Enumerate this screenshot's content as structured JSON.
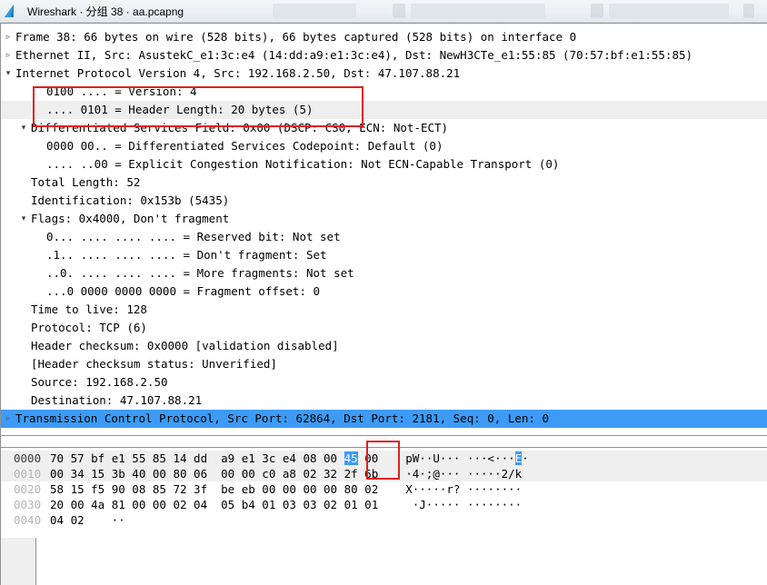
{
  "window": {
    "title": "Wireshark · 分组 38 · aa.pcapng",
    "logo_icon": "wireshark-fin-logo"
  },
  "detail_tree": {
    "rows": [
      {
        "indent": 0,
        "twig": "collapsed",
        "text": "Frame 38: 66 bytes on wire (528 bits), 66 bytes captured (528 bits) on interface 0",
        "state": "normal"
      },
      {
        "indent": 0,
        "twig": "collapsed",
        "text": "Ethernet II, Src: AsustekC_e1:3c:e4 (14:dd:a9:e1:3c:e4), Dst: NewH3CTe_e1:55:85 (70:57:bf:e1:55:85)",
        "state": "normal"
      },
      {
        "indent": 0,
        "twig": "expanded",
        "text": "Internet Protocol Version 4, Src: 192.168.2.50, Dst: 47.107.88.21",
        "state": "normal"
      },
      {
        "indent": 2,
        "twig": "none",
        "text": "0100 .... = Version: 4",
        "state": "normal"
      },
      {
        "indent": 2,
        "twig": "none",
        "text": ".... 0101 = Header Length: 20 bytes (5)",
        "state": "selected-field"
      },
      {
        "indent": 1,
        "twig": "expanded",
        "text": "Differentiated Services Field: 0x00 (DSCP: CS0, ECN: Not-ECT)",
        "state": "normal"
      },
      {
        "indent": 2,
        "twig": "none",
        "text": "0000 00.. = Differentiated Services Codepoint: Default (0)",
        "state": "normal"
      },
      {
        "indent": 2,
        "twig": "none",
        "text": ".... ..00 = Explicit Congestion Notification: Not ECN-Capable Transport (0)",
        "state": "normal"
      },
      {
        "indent": 1,
        "twig": "none",
        "text": "Total Length: 52",
        "state": "normal"
      },
      {
        "indent": 1,
        "twig": "none",
        "text": "Identification: 0x153b (5435)",
        "state": "normal"
      },
      {
        "indent": 1,
        "twig": "expanded",
        "text": "Flags: 0x4000, Don't fragment",
        "state": "normal"
      },
      {
        "indent": 2,
        "twig": "none",
        "text": "0... .... .... .... = Reserved bit: Not set",
        "state": "normal"
      },
      {
        "indent": 2,
        "twig": "none",
        "text": ".1.. .... .... .... = Don't fragment: Set",
        "state": "normal"
      },
      {
        "indent": 2,
        "twig": "none",
        "text": "..0. .... .... .... = More fragments: Not set",
        "state": "normal"
      },
      {
        "indent": 2,
        "twig": "none",
        "text": "...0 0000 0000 0000 = Fragment offset: 0",
        "state": "normal"
      },
      {
        "indent": 1,
        "twig": "none",
        "text": "Time to live: 128",
        "state": "normal"
      },
      {
        "indent": 1,
        "twig": "none",
        "text": "Protocol: TCP (6)",
        "state": "normal"
      },
      {
        "indent": 1,
        "twig": "none",
        "text": "Header checksum: 0x0000 [validation disabled]",
        "state": "normal"
      },
      {
        "indent": 1,
        "twig": "none",
        "text": "[Header checksum status: Unverified]",
        "state": "normal"
      },
      {
        "indent": 1,
        "twig": "none",
        "text": "Source: 192.168.2.50",
        "state": "normal"
      },
      {
        "indent": 1,
        "twig": "none",
        "text": "Destination: 47.107.88.21",
        "state": "normal"
      },
      {
        "indent": 0,
        "twig": "collapsed",
        "text": "Transmission Control Protocol, Src Port: 62864, Dst Port: 2181, Seq: 0, Len: 0",
        "state": "selected-row"
      }
    ]
  },
  "hex_dump": {
    "rows": [
      {
        "offset": "0000",
        "bytes_pre": "70 57 bf e1 55 85 14 dd  a9 e1 3c e4 08 00 ",
        "bytes_hl": "45",
        "bytes_post": " 00",
        "ascii_pre": "pW··U··· ···<···",
        "ascii_hl": "E",
        "ascii_post": "·",
        "shaded": true
      },
      {
        "offset": "0010",
        "bytes_pre": "00 34 15 3b 40 00 80 06  00 00 c0 a8 02 32 2f 6b",
        "bytes_hl": "",
        "bytes_post": "",
        "ascii_pre": "·4·;@··· ·····2/k",
        "ascii_hl": "",
        "ascii_post": "",
        "shaded": true
      },
      {
        "offset": "0020",
        "bytes_pre": "58 15 f5 90 08 85 72 3f  be eb 00 00 00 00 80 02",
        "bytes_hl": "",
        "bytes_post": "",
        "ascii_pre": "X·····r? ········",
        "ascii_hl": "",
        "ascii_post": "",
        "shaded": false
      },
      {
        "offset": "0030",
        "bytes_pre": "20 00 4a 81 00 00 02 04  05 b4 01 03 03 02 01 01",
        "bytes_hl": "",
        "bytes_post": "",
        "ascii_pre": " ·J····· ········",
        "ascii_hl": "",
        "ascii_post": "",
        "shaded": false
      },
      {
        "offset": "0040",
        "bytes_pre": "04 02",
        "bytes_hl": "",
        "bytes_post": "",
        "ascii_pre": "··",
        "ascii_hl": "",
        "ascii_post": "",
        "shaded": false
      }
    ]
  },
  "annotations": [
    {
      "name": "ip-version-headerlength-highlight",
      "color": "#e02020"
    },
    {
      "name": "hex-byte-45-highlight",
      "color": "#e02020"
    }
  ],
  "colors": {
    "selection_blue": "#3d9bf6",
    "selected_field_gray": "#eeeeee",
    "annotation_red": "#e02020",
    "hex_shade": "#efefef"
  }
}
